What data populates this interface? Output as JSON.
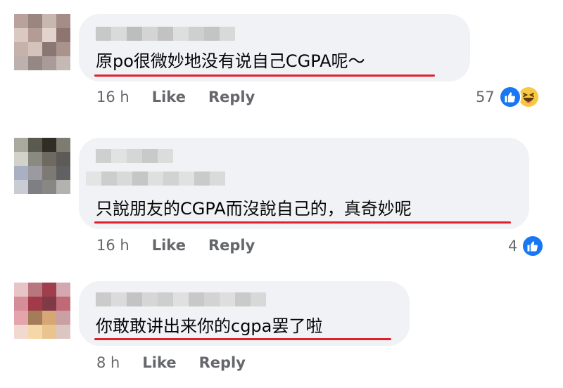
{
  "colors": {
    "bubble": "#f0f2f5",
    "underline": "#e0202a",
    "meta": "#65676b",
    "like_blue": "#1877f2",
    "haha_yellow": "#f7c843"
  },
  "comments": [
    {
      "text": "原po很微妙地没有说自己CGPA呢～",
      "time": "16 h",
      "like_label": "Like",
      "reply_label": "Reply",
      "reaction_count": "57",
      "reactions": [
        "like-icon",
        "haha-icon"
      ]
    },
    {
      "text": "只說朋友的CGPA而沒說自己的，真奇妙呢",
      "time": "16 h",
      "like_label": "Like",
      "reply_label": "Reply",
      "reaction_count": "4",
      "reactions": [
        "like-icon"
      ]
    },
    {
      "text": "你敢敢讲出来你的cgpa罢了啦",
      "time": "8 h",
      "like_label": "Like",
      "reply_label": "Reply",
      "reaction_count": "",
      "reactions": []
    }
  ]
}
